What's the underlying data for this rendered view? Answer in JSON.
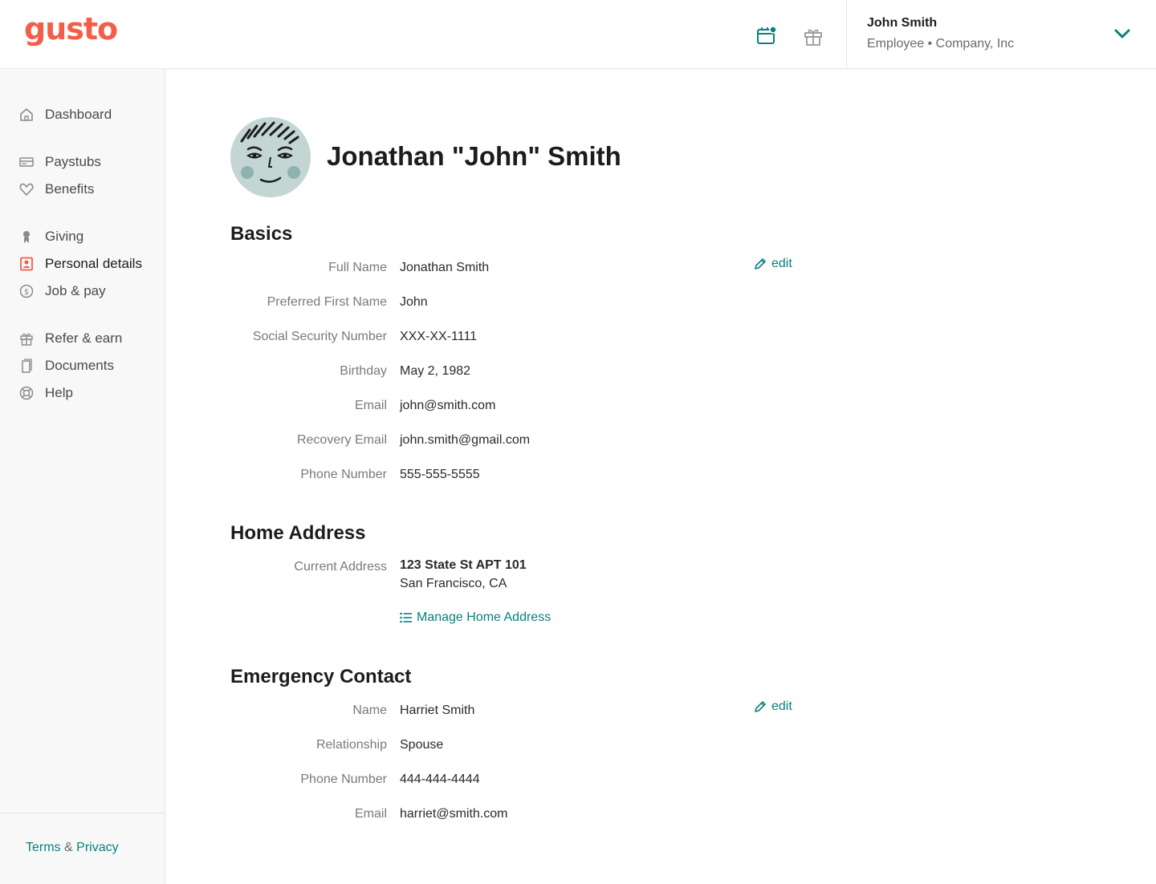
{
  "header": {
    "logo": "gusto",
    "user_name": "John Smith",
    "user_role": "Employee • Company, Inc"
  },
  "sidebar": {
    "items": [
      {
        "label": "Dashboard",
        "icon": "home-icon"
      },
      {
        "label": "Paystubs",
        "icon": "paystub-icon"
      },
      {
        "label": "Benefits",
        "icon": "heart-icon"
      },
      {
        "label": "Giving",
        "icon": "giving-icon"
      },
      {
        "label": "Personal details",
        "icon": "person-card-icon"
      },
      {
        "label": "Job & pay",
        "icon": "dollar-icon"
      },
      {
        "label": "Refer & earn",
        "icon": "gift-icon"
      },
      {
        "label": "Documents",
        "icon": "document-icon"
      },
      {
        "label": "Help",
        "icon": "lifebuoy-icon"
      }
    ],
    "footer_terms": "Terms",
    "footer_amp": "&",
    "footer_privacy": "Privacy"
  },
  "profile": {
    "name": "Jonathan \"John\" Smith"
  },
  "basics": {
    "title": "Basics",
    "edit_label": "edit",
    "fields": [
      {
        "label": "Full Name",
        "value": "Jonathan Smith"
      },
      {
        "label": "Preferred First Name",
        "value": "John"
      },
      {
        "label": "Social Security Number",
        "value": "XXX-XX-1111"
      },
      {
        "label": "Birthday",
        "value": "May 2, 1982"
      },
      {
        "label": "Email",
        "value": "john@smith.com"
      },
      {
        "label": "Recovery Email",
        "value": "john.smith@gmail.com"
      },
      {
        "label": "Phone Number",
        "value": "555-555-5555"
      }
    ]
  },
  "home_address": {
    "title": "Home Address",
    "label": "Current Address",
    "line1": "123 State St APT 101",
    "line2": "San Francisco, CA",
    "manage_label": "Manage Home Address"
  },
  "emergency_contact": {
    "title": "Emergency Contact",
    "edit_label": "edit",
    "fields": [
      {
        "label": "Name",
        "value": "Harriet Smith"
      },
      {
        "label": "Relationship",
        "value": "Spouse"
      },
      {
        "label": "Phone Number",
        "value": "444-444-4444"
      },
      {
        "label": "Email",
        "value": "harriet@smith.com"
      }
    ]
  },
  "colors": {
    "brand": "#f45d48",
    "accent": "#0a8080",
    "active_nav_icon": "#f45d48"
  }
}
